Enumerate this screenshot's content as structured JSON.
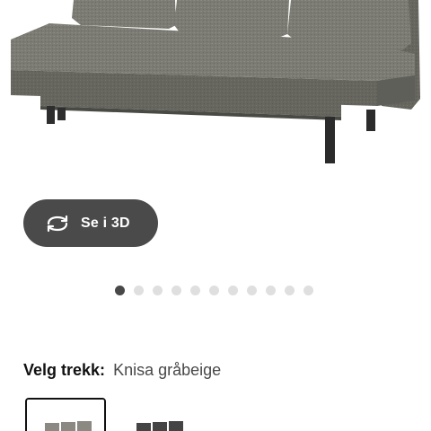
{
  "view_3d": {
    "label": "Se i 3D",
    "icon": "rotate-3d-icon"
  },
  "carousel": {
    "count": 11,
    "active_index": 0
  },
  "cover_selector": {
    "label": "Velg trekk:",
    "value": "Knisa gråbeige"
  },
  "swatches": [
    {
      "name": "Knisa gråbeige",
      "selected": true
    },
    {
      "name": "dark-grey-variant",
      "selected": false
    }
  ],
  "colors": {
    "button_bg": "#4a4a4a",
    "dot_active": "#484848",
    "dot_inactive": "#dfdfdf",
    "sofa_fabric": "#7a7a72",
    "sofa_dark": "#3f3f3f"
  }
}
